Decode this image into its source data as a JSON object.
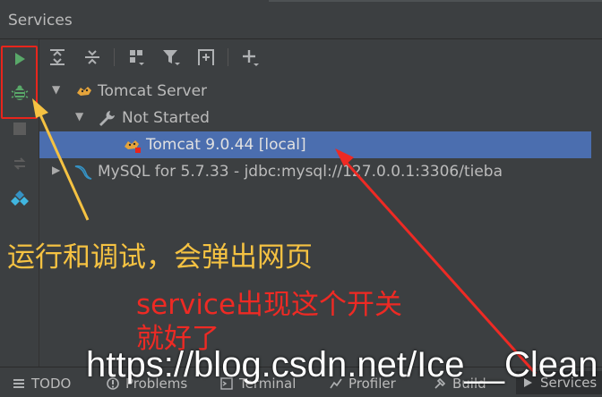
{
  "window": {
    "title": "Services"
  },
  "left_toolbar": {
    "items": [
      {
        "icon": "run-icon"
      },
      {
        "icon": "debug-icon"
      },
      {
        "icon": "stop-icon"
      },
      {
        "icon": "deploy-icon"
      },
      {
        "icon": "plugin-icon"
      }
    ]
  },
  "toolbar": {
    "items": [
      {
        "icon": "expand-all-icon"
      },
      {
        "icon": "collapse-all-icon"
      },
      {
        "icon": "group-by-icon"
      },
      {
        "icon": "filter-icon"
      },
      {
        "icon": "new-tab-icon"
      },
      {
        "icon": "add-icon"
      }
    ]
  },
  "tree": {
    "rows": [
      {
        "label": "Tomcat Server",
        "level": 1,
        "expanded": true,
        "icon": "tomcat-icon"
      },
      {
        "label": "Not Started",
        "level": 2,
        "expanded": true,
        "icon": "wrench-icon"
      },
      {
        "label": "Tomcat 9.0.44 [local]",
        "level": 3,
        "selected": true,
        "icon": "tomcat-instance-icon"
      },
      {
        "label": "MySQL for 5.7.33 - jdbc:mysql://127.0.0.1:3306/tieba",
        "level": 1,
        "expanded": false,
        "icon": "mysql-icon"
      }
    ]
  },
  "statusbar": {
    "items": [
      {
        "label": "TODO",
        "icon": "list-icon"
      },
      {
        "label": "Problems",
        "icon": "problems-icon"
      },
      {
        "label": "Terminal",
        "icon": "terminal-icon"
      },
      {
        "label": "Profiler",
        "icon": "profiler-icon"
      },
      {
        "label": "Build",
        "icon": "build-icon"
      },
      {
        "label": "Services",
        "icon": "services-icon",
        "active": true
      }
    ]
  },
  "annotations": {
    "yellow_text": "运行和调试，会弹出网页",
    "red_text_line1": "service出现这个开关",
    "red_text_line2": "就好了",
    "watermark": "https://blog.csdn.net/Ice__Clean"
  },
  "colors": {
    "background": "#3c3f41",
    "selection": "#4b6eaf",
    "run_green": "#59a869",
    "annotation_yellow": "#f5c242",
    "annotation_red": "#ee2a24"
  }
}
